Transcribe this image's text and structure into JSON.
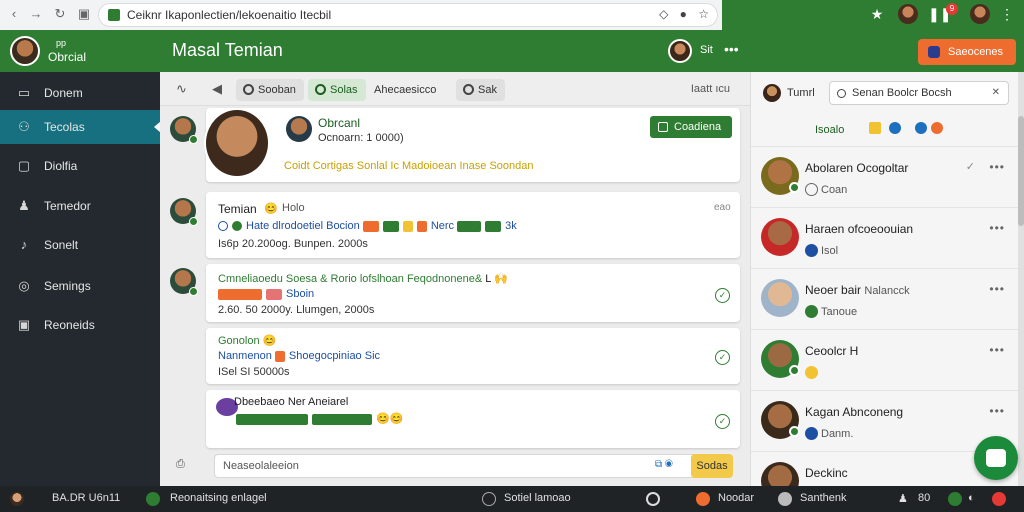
{
  "browser": {
    "url": "Ceiknr Ikaponlectien/lekoenaitio Itecbil",
    "right_labels": [
      "9"
    ]
  },
  "sidebar": {
    "badge": "pp",
    "user_name": "Obrcial",
    "items": [
      {
        "label": "Donem",
        "icon": "grid-icon"
      },
      {
        "label": "Tecolas",
        "icon": "team-icon",
        "active": true
      },
      {
        "label": "Diolfia",
        "icon": "chat-icon"
      },
      {
        "label": "Temedor",
        "icon": "person-icon"
      },
      {
        "label": "Sonelt",
        "icon": "bell-icon"
      },
      {
        "label": "Semings",
        "icon": "settings-icon"
      },
      {
        "label": "Reoneids",
        "icon": "folder-icon"
      }
    ]
  },
  "main": {
    "title": "Masal Temian",
    "user_label": "Sit",
    "toolbar": {
      "tabs": [
        "Sooban",
        "Solas",
        "Ahecaesicco",
        "Sak"
      ],
      "right_text": "Iaatt ıcu"
    },
    "messages": [
      {
        "name": "Obrcanl",
        "sub": "Ocnoarn: 1 0000)",
        "button": "Coadiena",
        "body": "Coidt Cortigas  Sonlal Ic Madoioean Inase Soondan"
      },
      {
        "name": "Temian",
        "name_suffix": "Holo",
        "time": "eao",
        "line2": "Hate dlrodoetiel  Bocion",
        "line2_tail": "Nerc",
        "line2_end": "3k",
        "line3": "Is6p 20.200og.  Bunpen. 2000s"
      },
      {
        "line1": "Cmneliaoedu Soesa &  Rorio lofslhoan  Feqodnonene& ",
        "line1_end": "L",
        "line2": "Sboin",
        "line3": "2.60. 50 2000y.  Llumgen, 2000s"
      },
      {
        "line1": "Gonolon",
        "line2": "Nanmenon",
        "line2_tail": "Shoegocpiniao Sic",
        "line3": "ISel  SI 50000s"
      },
      {
        "line1": "Dbeebaeo Ner Aneiarel"
      }
    ],
    "composer_placeholder": "Neaseolaleeion",
    "composer_send": "Sodas"
  },
  "right_header": {
    "button_label": "Saeocenes"
  },
  "right_panel": {
    "top_name": "Tumrl",
    "search_label": "Senan  Boolcr Bocsh",
    "filter_label": "Isoalo",
    "contacts": [
      {
        "name": "Abolaren Ocogoltar",
        "sub": "Coan"
      },
      {
        "name": "Haraen ofcoeoouian",
        "sub": "Isol"
      },
      {
        "name": "Neoer bair",
        "name_tail": "Nalancck",
        "sub": "Tanoue"
      },
      {
        "name": "Ceoolcr H",
        "sub": ""
      },
      {
        "name": "Kagan Abnconeng",
        "sub": "Danm."
      },
      {
        "name": "Deckinc",
        "sub": ""
      }
    ]
  },
  "bottom_bar": {
    "left": "BA.DR U6n11",
    "status": "Reonaitsing enlagel",
    "center": "Sotiel lamoao",
    "right1": "Noodar",
    "right2": "Santhenk",
    "right3": "80"
  },
  "colors": {
    "primary_green": "#2e7d32",
    "sidebar_bg": "#23292e",
    "active_teal": "#17707f",
    "accent_orange": "#ef6c2f"
  }
}
